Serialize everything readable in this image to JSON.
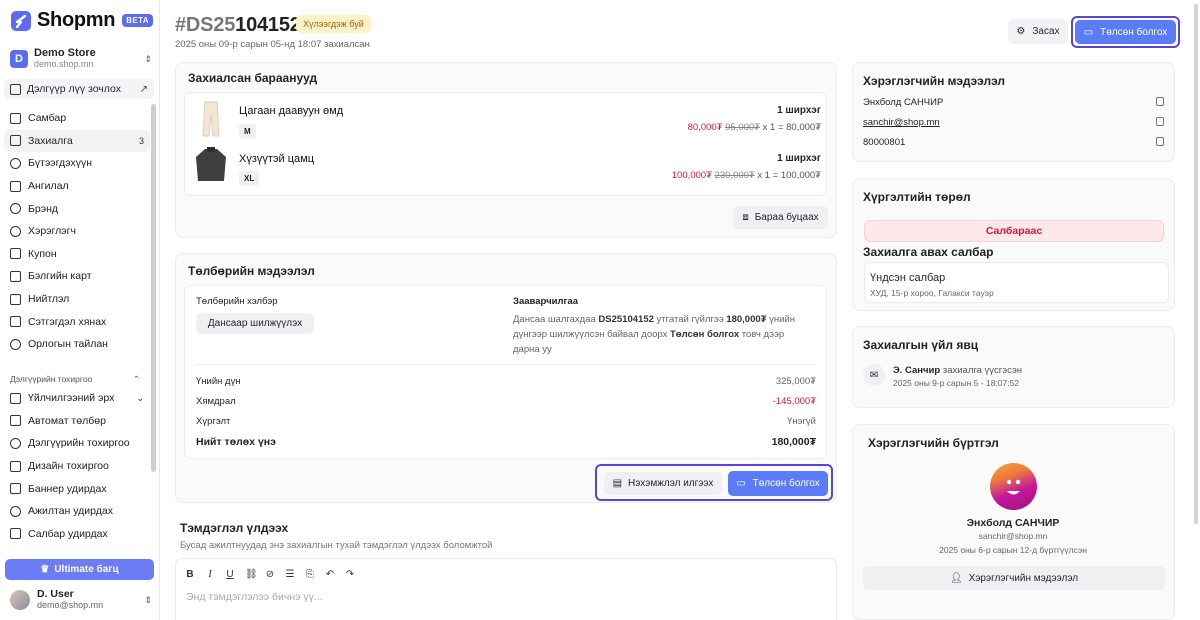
{
  "sidebar": {
    "logo": "Shopmn",
    "beta": "BETA",
    "store_name": "Demo Store",
    "store_url": "demo.shop.mn",
    "visit_store": "Дэлгүүр лүү зочлох",
    "items": [
      {
        "label": "Самбар",
        "icon": "home-icon"
      },
      {
        "label": "Захиалга",
        "icon": "inbox-icon",
        "badge": "3"
      },
      {
        "label": "Бүтээгдэхүүн",
        "icon": "box-icon"
      },
      {
        "label": "Ангилал",
        "icon": "category-icon"
      },
      {
        "label": "Брэнд",
        "icon": "tag-icon"
      },
      {
        "label": "Хэрэглэгч",
        "icon": "users-icon"
      },
      {
        "label": "Купон",
        "icon": "ticket-icon"
      },
      {
        "label": "Бэлгийн карт",
        "icon": "gift-card-icon"
      },
      {
        "label": "Нийтлэл",
        "icon": "article-icon"
      },
      {
        "label": "Сэтгэгдэл хянах",
        "icon": "comment-icon"
      },
      {
        "label": "Орлогын тайлан",
        "icon": "report-icon"
      }
    ],
    "section_title": "Дэлгүүрийн тохиргоо",
    "items2": [
      {
        "label": "Үйлчилгээний эрх",
        "icon": "license-icon"
      },
      {
        "label": "Автомат төлбөр",
        "icon": "payment-icon"
      },
      {
        "label": "Дэлгүүрийн тохиргоо",
        "icon": "gear-icon"
      },
      {
        "label": "Дизайн тохиргоо",
        "icon": "brush-icon"
      },
      {
        "label": "Баннер удирдах",
        "icon": "banner-icon"
      },
      {
        "label": "Ажилтан удирдах",
        "icon": "staff-icon"
      },
      {
        "label": "Салбар удирдах",
        "icon": "branch-icon"
      }
    ],
    "ultimate": "Ultimate багц",
    "user_name": "D. User",
    "user_email": "demo@shop.mn"
  },
  "header": {
    "order_prefix": "#DS25",
    "order_num": "104152",
    "status": "Хүлээгдэж буй",
    "subtitle": "2025 оны 09-р сарын 05-нд 18:07 захиалсан",
    "edit": "Засах",
    "paid": "Төлсөн болгох"
  },
  "items_card": {
    "title": "Захиалсан бараанууд",
    "products": [
      {
        "name": "Цагаан даавуун өмд",
        "size": "M",
        "qty": "1 ширхэг",
        "sale": "80,000₮",
        "orig": "95,000₮",
        "calc": "x 1 = 80,000₮"
      },
      {
        "name": "Хүзүүтэй цамц",
        "size": "XL",
        "qty": "1 ширхэг",
        "sale": "100,000₮",
        "orig": "230,000₮",
        "calc": "x 1 = 100,000₮"
      }
    ],
    "return_btn": "Бараа буцаах"
  },
  "payment": {
    "title": "Төлбөрийн мэдээлэл",
    "method_label": "Төлбөрийн хэлбэр",
    "method": "Дансаар шилжүүлэх",
    "instr_label": "Зааварчилгаа",
    "instr_a": "Дансаа шалгахдаа ",
    "instr_b": "DS25104152",
    "instr_c": " утгатай гүйлгээ ",
    "instr_d": "180,000₮",
    "instr_e": " үнийн дүнгээр шилжүүлсэн байвал доорх ",
    "instr_f": "Төлсөн болгох",
    "instr_g": " товч дээр дарна уу",
    "rows": [
      {
        "label": "Үнийн дүн",
        "value": "325,000₮"
      },
      {
        "label": "Хямдрал",
        "value": "-145,000₮"
      },
      {
        "label": "Хүргэлт",
        "value": "Үнэгүй"
      },
      {
        "label": "Нийт төлөх үнэ",
        "value": "180,000₮"
      }
    ],
    "invoice_btn": "Нэхэмжлэл илгээх",
    "paid_btn": "Төлсөн болгох"
  },
  "notes": {
    "title": "Тэмдэглэл үлдээх",
    "subtitle": "Бусад ажилтнуудад энэ захиалгын тухай тэмдэглэл үлдээх боломжтой",
    "placeholder": "Энд тэмдэглэлээ бичнэ үү..."
  },
  "customer": {
    "title": "Хэрэглэгчийн мэдээлэл",
    "name": "Энхболд САНЧИР",
    "email": "sanchir@shop.mn",
    "phone": "80000801"
  },
  "delivery": {
    "title": "Хүргэлтийн төрөл",
    "type": "Салбараас",
    "pickup_title": "Захиалга авах салбар",
    "branch_name": "Үндсэн салбар",
    "branch_addr": "ХУД, 15-р хороо, Галакси тауэр"
  },
  "timeline": {
    "title": "Захиалгын үйл явц",
    "actor": "Э. Санчир",
    "action": " захиалга үүсгэсэн",
    "time": "2025 оны 9-р сарын 5 - 18:07:52"
  },
  "account": {
    "title": "Хэрэглэгчийн бүртгэл",
    "name": "Энхболд САНЧИР",
    "email": "sanchir@shop.mn",
    "registered": "2025 оны 6-р сарын 12-д бүртгүүлсэн",
    "btn": "Хэрэглэгчийн мэдээлэл"
  },
  "colors": {
    "accent": "#5b7cf6",
    "highlight": "#5a44e0",
    "danger": "#d4183d"
  }
}
